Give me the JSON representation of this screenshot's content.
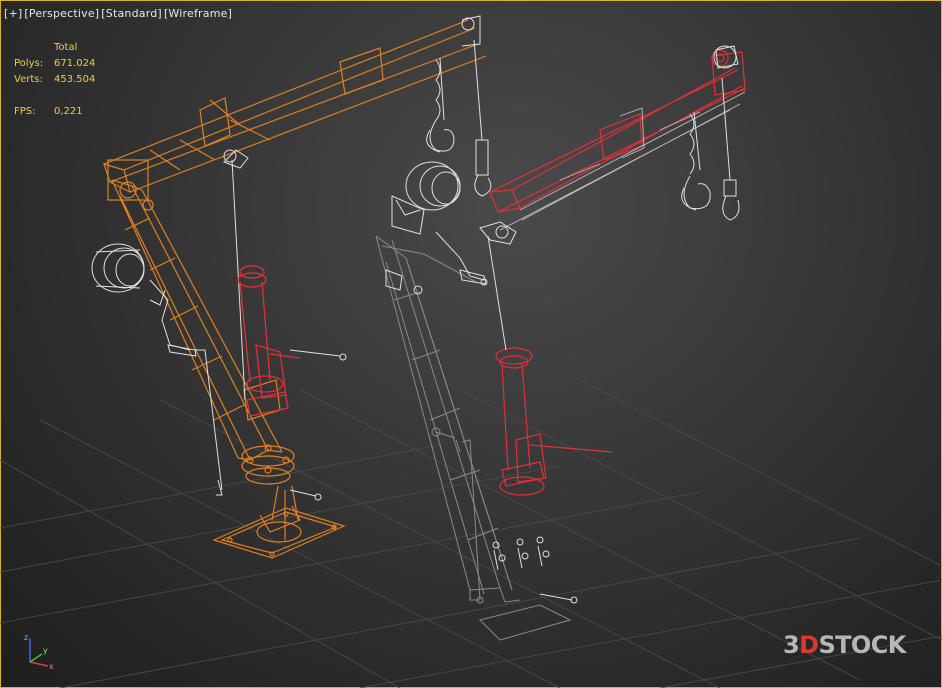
{
  "viewport_labels": {
    "plus": "[+]",
    "view": "[Perspective]",
    "shading_preset": "[Standard]",
    "shading_mode": "[Wireframe]"
  },
  "stats": {
    "header": "Total",
    "polys_label": "Polys:",
    "polys_value": "671.024",
    "verts_label": "Verts:",
    "verts_value": "453.504",
    "fps_label": "FPS:",
    "fps_value": "0,221"
  },
  "watermark": {
    "prefix": "3",
    "accent": "D",
    "rest": "STOCK"
  },
  "colors": {
    "selection_orange": "#e08020",
    "highlight_red": "#e0303a",
    "wire_white": "#e0e0e0",
    "wire_grey": "#8a8a8a",
    "stats_yellow": "#e8d23a",
    "viewport_border": "#d8b42a",
    "logo_red": "#d83a2e",
    "logo_grey": "#b7b7b7"
  },
  "axis_gizmo": {
    "x": "x",
    "y": "y",
    "z": "z"
  }
}
